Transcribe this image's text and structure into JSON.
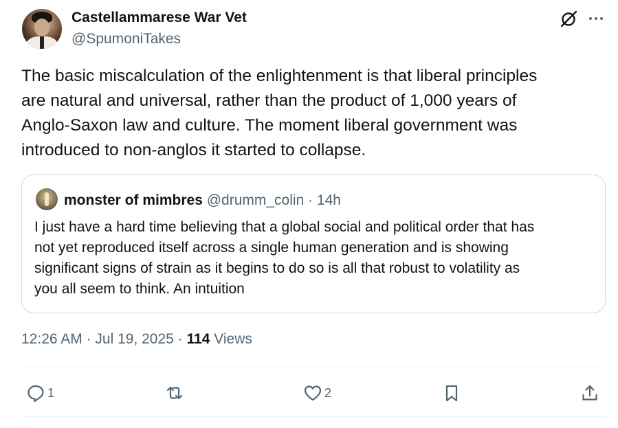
{
  "author": {
    "display_name": "Castellammarese War Vet",
    "handle": "@SpumoniTakes"
  },
  "tweet": {
    "text": "The basic miscalculation of the enlightenment is that liberal principles\nare natural and universal, rather than the product of 1,000 years of\nAnglo-Saxon law and culture. The moment liberal government was\nintroduced to non-anglos it started to collapse."
  },
  "quote": {
    "display_name": "monster of mimbres",
    "meta": " @drumm_colin · 14h",
    "text": "I just have a hard time believing that a global social and political order that has\nnot yet reproduced itself across a single human generation and is showing\nsignificant signs of strain as it begins to do so is all that robust to volatility as\nyou all seem to think. An intuition"
  },
  "meta": {
    "time": "12:26 AM",
    "separator1": " · ",
    "date": "Jul 19, 2025",
    "separator2": " · ",
    "views_count": "114",
    "views_label": " Views"
  },
  "actions": {
    "reply_count": "1",
    "like_count": "2"
  },
  "colors": {
    "text_primary": "#0f1419",
    "text_secondary": "#536471",
    "border": "#cfd9de",
    "divider": "#eff3f4"
  },
  "icons": [
    "grok-icon",
    "more-icon",
    "reply-icon",
    "retweet-icon",
    "like-icon",
    "bookmark-icon",
    "share-icon"
  ]
}
